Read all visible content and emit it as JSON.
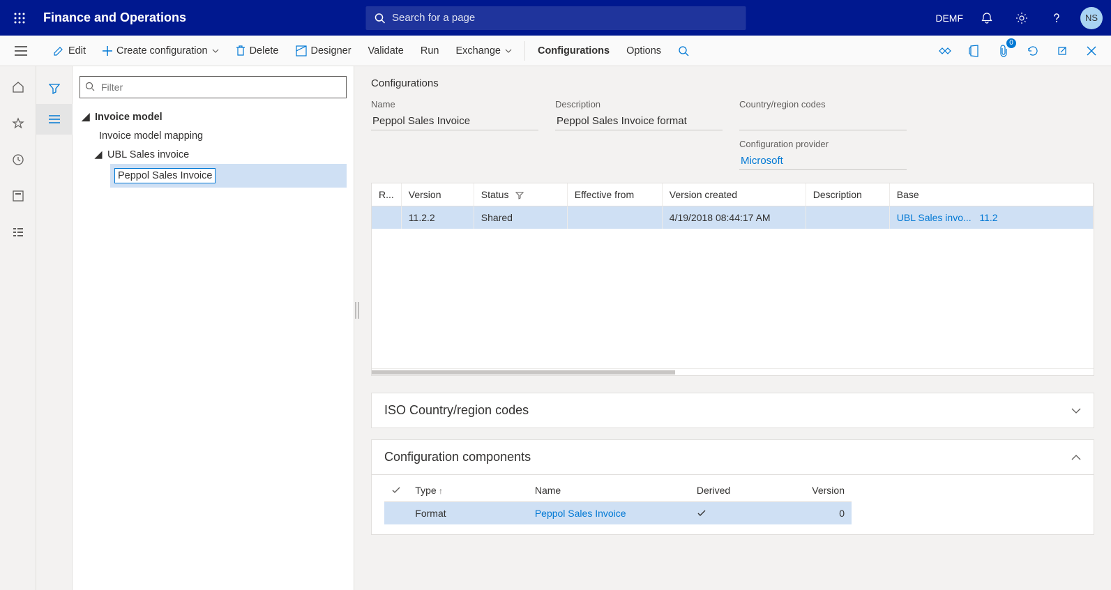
{
  "header": {
    "app_title": "Finance and Operations",
    "search_placeholder": "Search for a page",
    "company": "DEMF",
    "avatar_initials": "NS"
  },
  "actionbar": {
    "edit": "Edit",
    "create": "Create configuration",
    "delete": "Delete",
    "designer": "Designer",
    "validate": "Validate",
    "run": "Run",
    "exchange": "Exchange",
    "configurations": "Configurations",
    "options": "Options",
    "attach_badge": "0"
  },
  "tree": {
    "filter_placeholder": "Filter",
    "root": "Invoice model",
    "child1": "Invoice model mapping",
    "child2": "UBL Sales invoice",
    "leaf": "Peppol Sales Invoice"
  },
  "config": {
    "section_title": "Configurations",
    "labels": {
      "name": "Name",
      "description": "Description",
      "country": "Country/region codes",
      "provider": "Configuration provider"
    },
    "name": "Peppol Sales Invoice",
    "description": "Peppol Sales Invoice format",
    "country": "",
    "provider": "Microsoft"
  },
  "versions": {
    "headers": {
      "r": "R...",
      "version": "Version",
      "status": "Status",
      "effective": "Effective from",
      "created": "Version created",
      "description": "Description",
      "base": "Base"
    },
    "row": {
      "version": "11.2.2",
      "status": "Shared",
      "effective": "",
      "created": "4/19/2018 08:44:17 AM",
      "description": "",
      "base_name": "UBL Sales invo...",
      "base_ver": "11.2"
    }
  },
  "iso_section": "ISO Country/region codes",
  "components": {
    "title": "Configuration components",
    "headers": {
      "type": "Type",
      "name": "Name",
      "derived": "Derived",
      "version": "Version"
    },
    "row": {
      "type": "Format",
      "name": "Peppol Sales Invoice",
      "version": "0"
    }
  }
}
